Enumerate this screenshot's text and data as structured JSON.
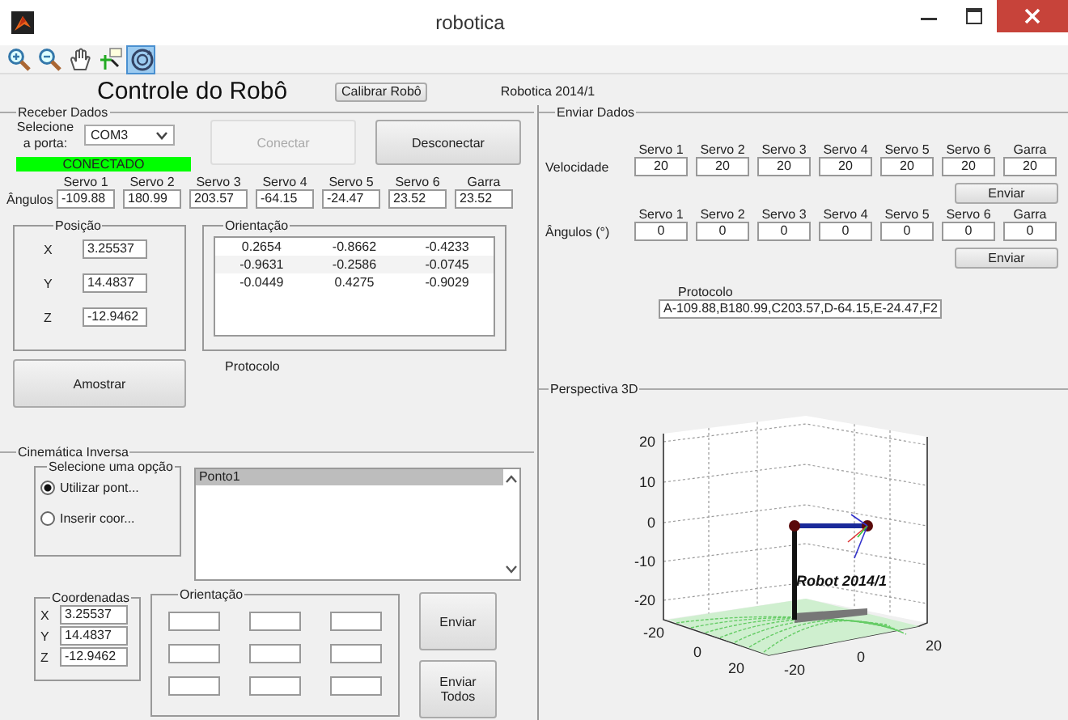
{
  "window": {
    "title": "robotica"
  },
  "toolbar": [
    {
      "kind": "zoom-in",
      "selected": false
    },
    {
      "kind": "zoom-out",
      "selected": false
    },
    {
      "kind": "pan",
      "selected": false
    },
    {
      "kind": "data-cursor",
      "selected": false
    },
    {
      "kind": "rotate",
      "selected": true
    }
  ],
  "header": {
    "title": "Controle do Robô",
    "calibrate_button": "Calibrar Robô",
    "subtitle": "Robotica 2014/1"
  },
  "receive": {
    "legend": "Receber Dados",
    "port_label": "Selecione a porta:",
    "port": "COM3",
    "connect_button": {
      "label": "Conectar",
      "disabled": true
    },
    "disconnect_button": {
      "label": "Desconectar",
      "disabled": false
    },
    "status": "CONECTADO",
    "angles_label": "Ângulos",
    "servos": [
      {
        "name": "Servo 1",
        "value": "-109.88"
      },
      {
        "name": "Servo 2",
        "value": "180.99"
      },
      {
        "name": "Servo 3",
        "value": "203.57"
      },
      {
        "name": "Servo 4",
        "value": "-64.15"
      },
      {
        "name": "Servo 5",
        "value": "-24.47"
      },
      {
        "name": "Servo 6",
        "value": "23.52"
      },
      {
        "name": "Garra",
        "value": "23.52"
      }
    ],
    "position": {
      "legend": "Posição",
      "fields": [
        {
          "axis": "X",
          "value": "3.25537"
        },
        {
          "axis": "Y",
          "value": "14.4837"
        },
        {
          "axis": "Z",
          "value": "-12.9462"
        }
      ]
    },
    "orientation": {
      "legend": "Orientação",
      "rows": [
        [
          "0.2654",
          "-0.8662",
          "-0.4233"
        ],
        [
          "-0.9631",
          "-0.2586",
          "-0.0745"
        ],
        [
          "-0.0449",
          "0.4275",
          "-0.9029"
        ]
      ]
    },
    "sample_button": "Amostrar",
    "protocol_label": "Protocolo"
  },
  "inverse": {
    "legend": "Cinemática Inversa",
    "option_legend": "Selecione uma opção",
    "options": [
      {
        "label": "Utilizar pont...",
        "selected": true
      },
      {
        "label": "Inserir coor...",
        "selected": false
      }
    ],
    "points": [
      {
        "label": "Ponto1",
        "selected": true
      }
    ],
    "coords": {
      "legend": "Coordenadas",
      "fields": [
        {
          "axis": "X",
          "value": "3.25537"
        },
        {
          "axis": "Y",
          "value": "14.4837"
        },
        {
          "axis": "Z",
          "value": "-12.9462"
        }
      ]
    },
    "orientation_legend": "Orientação",
    "send_button": "Enviar",
    "send_all_button": "Enviar Todos"
  },
  "send": {
    "legend": "Enviar Dados",
    "rows": [
      {
        "label": "Velocidade",
        "button": "Enviar",
        "servos": [
          {
            "name": "Servo 1",
            "value": "20"
          },
          {
            "name": "Servo 2",
            "value": "20"
          },
          {
            "name": "Servo 3",
            "value": "20"
          },
          {
            "name": "Servo 4",
            "value": "20"
          },
          {
            "name": "Servo 5",
            "value": "20"
          },
          {
            "name": "Servo 6",
            "value": "20"
          },
          {
            "name": "Garra",
            "value": "20"
          }
        ]
      },
      {
        "label": "Ângulos (°)",
        "button": "Enviar",
        "servos": [
          {
            "name": "Servo 1",
            "value": "0"
          },
          {
            "name": "Servo 2",
            "value": "0"
          },
          {
            "name": "Servo 3",
            "value": "0"
          },
          {
            "name": "Servo 4",
            "value": "0"
          },
          {
            "name": "Servo 5",
            "value": "0"
          },
          {
            "name": "Servo 6",
            "value": "0"
          },
          {
            "name": "Garra",
            "value": "0"
          }
        ]
      }
    ],
    "protocol_label": "Protocolo",
    "protocol": "A-109.88,B180.99,C203.57,D-64.15,E-24.47,F2"
  },
  "perspective": {
    "legend": "Perspectiva 3D",
    "z_ticks": [
      "20",
      "10",
      "0",
      "-10",
      "-20"
    ],
    "x_ticks": [
      "-20",
      "0",
      "20"
    ],
    "y_ticks": [
      "-20",
      "0",
      "20"
    ],
    "label": "Robot 2014/1"
  }
}
